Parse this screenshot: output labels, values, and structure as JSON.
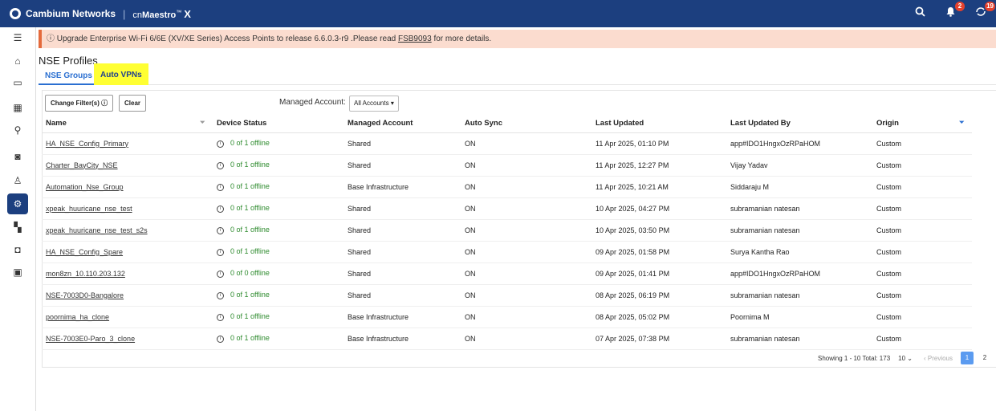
{
  "topbar": {
    "brand": "Cambium Networks",
    "product_prefix": "cn",
    "product_name": "Maestro",
    "product_tm": "™",
    "product_x": "X",
    "notifications_count": "2",
    "sync_count": "19"
  },
  "banner": {
    "text": "Upgrade Enterprise Wi-Fi 6/6E (XV/XE Series) Access Points to release 6.6.0.3-r9 .Please read ",
    "link": "FSB9093",
    "suffix": " for more details."
  },
  "page": {
    "title": "NSE Profiles",
    "tabs": [
      "NSE Groups",
      "Auto VPNs"
    ]
  },
  "toolbar": {
    "change_filters": "Change Filter(s)",
    "clear": "Clear",
    "managed_account_label": "Managed Account:",
    "managed_account_value": "All Accounts"
  },
  "table": {
    "headers": [
      "Name",
      "Device Status",
      "Managed Account",
      "Auto Sync",
      "Last Updated",
      "Last Updated By",
      "Origin"
    ],
    "rows": [
      {
        "name": "HA_NSE_Config_Primary",
        "status": "0 of 1 offline",
        "account": "Shared",
        "sync": "ON",
        "updated": "11 Apr 2025, 01:10 PM",
        "by": "app#IDO1HngxOzRPaHOM",
        "origin": "Custom"
      },
      {
        "name": "Charter_BayCity_NSE",
        "status": "0 of 1 offline",
        "account": "Shared",
        "sync": "ON",
        "updated": "11 Apr 2025, 12:27 PM",
        "by": "Vijay Yadav",
        "origin": "Custom"
      },
      {
        "name": "Automation_Nse_Group",
        "status": "0 of 1 offline",
        "account": "Base Infrastructure",
        "sync": "ON",
        "updated": "11 Apr 2025, 10:21 AM",
        "by": "Siddaraju M",
        "origin": "Custom"
      },
      {
        "name": "xpeak_huuricane_nse_test",
        "status": "0 of 1 offline",
        "account": "Shared",
        "sync": "ON",
        "updated": "10 Apr 2025, 04:27 PM",
        "by": "subramanian natesan",
        "origin": "Custom"
      },
      {
        "name": "xpeak_huuricane_nse_test_s2s",
        "status": "0 of 1 offline",
        "account": "Shared",
        "sync": "ON",
        "updated": "10 Apr 2025, 03:50 PM",
        "by": "subramanian natesan",
        "origin": "Custom"
      },
      {
        "name": "HA_NSE_Config_Spare",
        "status": "0 of 1 offline",
        "account": "Shared",
        "sync": "ON",
        "updated": "09 Apr 2025, 01:58 PM",
        "by": "Surya Kantha Rao",
        "origin": "Custom"
      },
      {
        "name": "mon8zn_10.110.203.132",
        "status": "0 of 0 offline",
        "account": "Shared",
        "sync": "ON",
        "updated": "09 Apr 2025, 01:41 PM",
        "by": "app#IDO1HngxOzRPaHOM",
        "origin": "Custom"
      },
      {
        "name": "NSE-7003D0-Bangalore",
        "status": "0 of 1 offline",
        "account": "Shared",
        "sync": "ON",
        "updated": "08 Apr 2025, 06:19 PM",
        "by": "subramanian natesan",
        "origin": "Custom"
      },
      {
        "name": "poornima_ha_clone",
        "status": "0 of 1 offline",
        "account": "Base Infrastructure",
        "sync": "ON",
        "updated": "08 Apr 2025, 05:02 PM",
        "by": "Poornima M",
        "origin": "Custom"
      },
      {
        "name": "NSE-7003E0-Paro_3_clone",
        "status": "0 of 1 offline",
        "account": "Base Infrastructure",
        "sync": "ON",
        "updated": "07 Apr 2025, 07:38 PM",
        "by": "subramanian natesan",
        "origin": "Custom"
      }
    ]
  },
  "pager": {
    "summary": "Showing 1 - 10 Total: 173",
    "page_size": "10",
    "previous": "Previous",
    "pages": [
      "1",
      "2"
    ]
  }
}
